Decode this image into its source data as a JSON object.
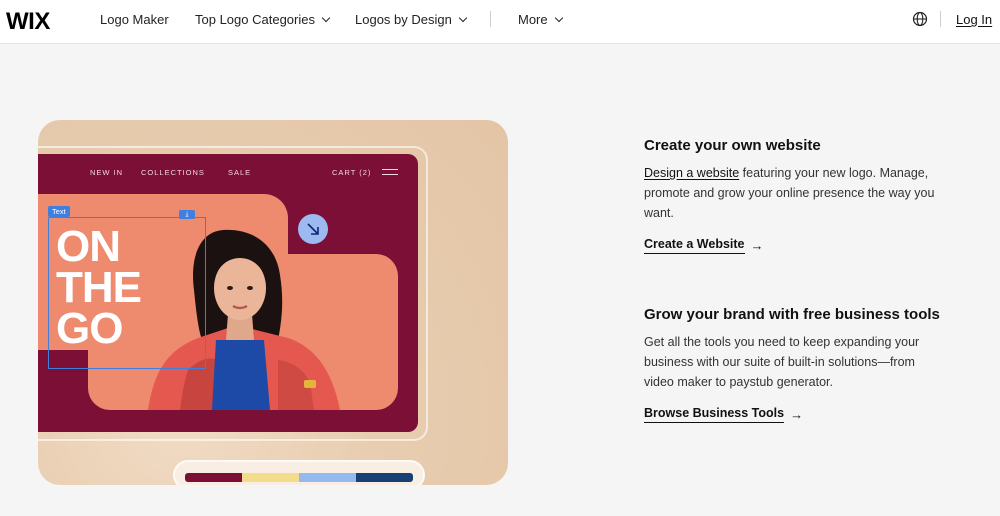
{
  "header": {
    "logo": "WIX",
    "nav": [
      {
        "label": "Logo Maker",
        "dropdown": false
      },
      {
        "label": "Top Logo Categories",
        "dropdown": true
      },
      {
        "label": "Logos by Design",
        "dropdown": true
      },
      {
        "label": "More",
        "dropdown": true
      }
    ],
    "globe_icon": "globe-icon",
    "login_label": "Log In"
  },
  "illustration": {
    "site_nav": [
      "NEW IN",
      "COLLECTIONS",
      "SALE"
    ],
    "cart_label": "CART (2)",
    "hero_text": [
      "ON",
      "THE",
      "GO"
    ],
    "selection_tag": "Text",
    "palette": [
      "#7b0f36",
      "#f3dc8c",
      "#93b9ef",
      "#173f73"
    ]
  },
  "sections": [
    {
      "title": "Create your own website",
      "body_link": "Design a website",
      "body_rest": " featuring your new logo. Manage, promote and grow your online presence the way you want.",
      "cta": "Create a Website"
    },
    {
      "title": "Grow your brand with free business tools",
      "body_link": "",
      "body_rest": "Get all the tools you need to keep expanding your business with our suite of built-in solutions—from video maker to paystub generator.",
      "cta": "Browse Business Tools"
    }
  ],
  "colors": {
    "accent_burgundy": "#7b0f36",
    "salmon": "#ee8a6e",
    "selection_blue": "#3f7fe0"
  }
}
